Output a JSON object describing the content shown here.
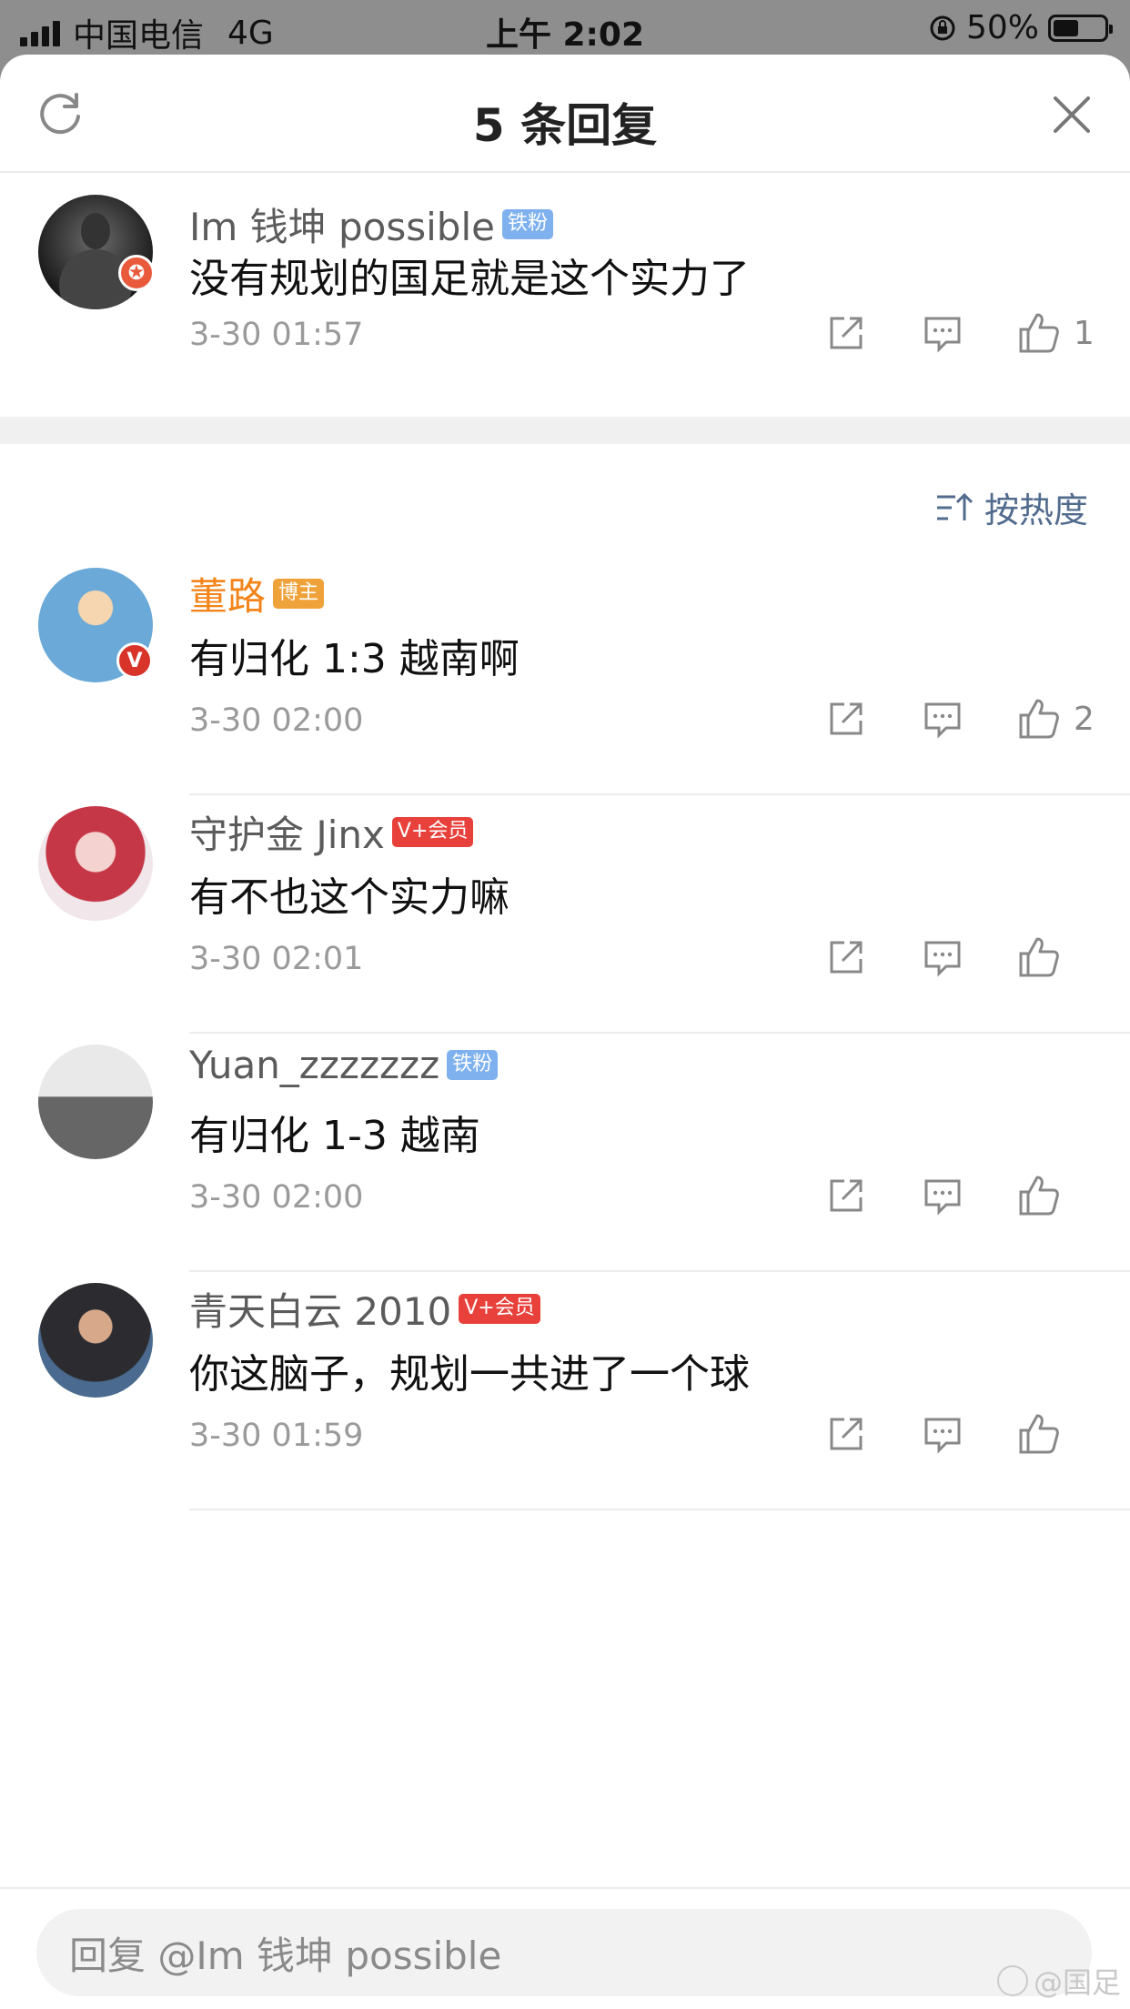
{
  "status_bar": {
    "carrier": "中国电信",
    "network": "4G",
    "time": "上午 2:02",
    "battery": "50%",
    "battery_level": 0.5
  },
  "header": {
    "title": "5 条回复"
  },
  "main_comment": {
    "username": "Im 钱坤 possible",
    "tag": "铁粉",
    "content": "没有规划的国足就是这个实力了",
    "time": "3-30 01:57",
    "likes": "1"
  },
  "sort": {
    "label": "按热度"
  },
  "replies": [
    {
      "username": "董路",
      "tag": "博主",
      "content": "有归化 1:3 越南啊",
      "time": "3-30 02:00",
      "likes": "2"
    },
    {
      "username": "守护金 Jinx",
      "tag": "V+会员",
      "content": "有不也这个实力嘛",
      "time": "3-30 02:01",
      "likes": ""
    },
    {
      "username": "Yuan_zzzzzzz",
      "tag": "铁粉",
      "content": "有归化 1-3 越南",
      "time": "3-30 02:00",
      "likes": ""
    },
    {
      "username": "青天白云 2010",
      "tag": "V+会员",
      "content": "你这脑子，规划一共进了一个球",
      "time": "3-30 01:59",
      "likes": ""
    }
  ],
  "footer": {
    "placeholder": "回复 @Im 钱坤 possible",
    "watermark": "@国足"
  }
}
